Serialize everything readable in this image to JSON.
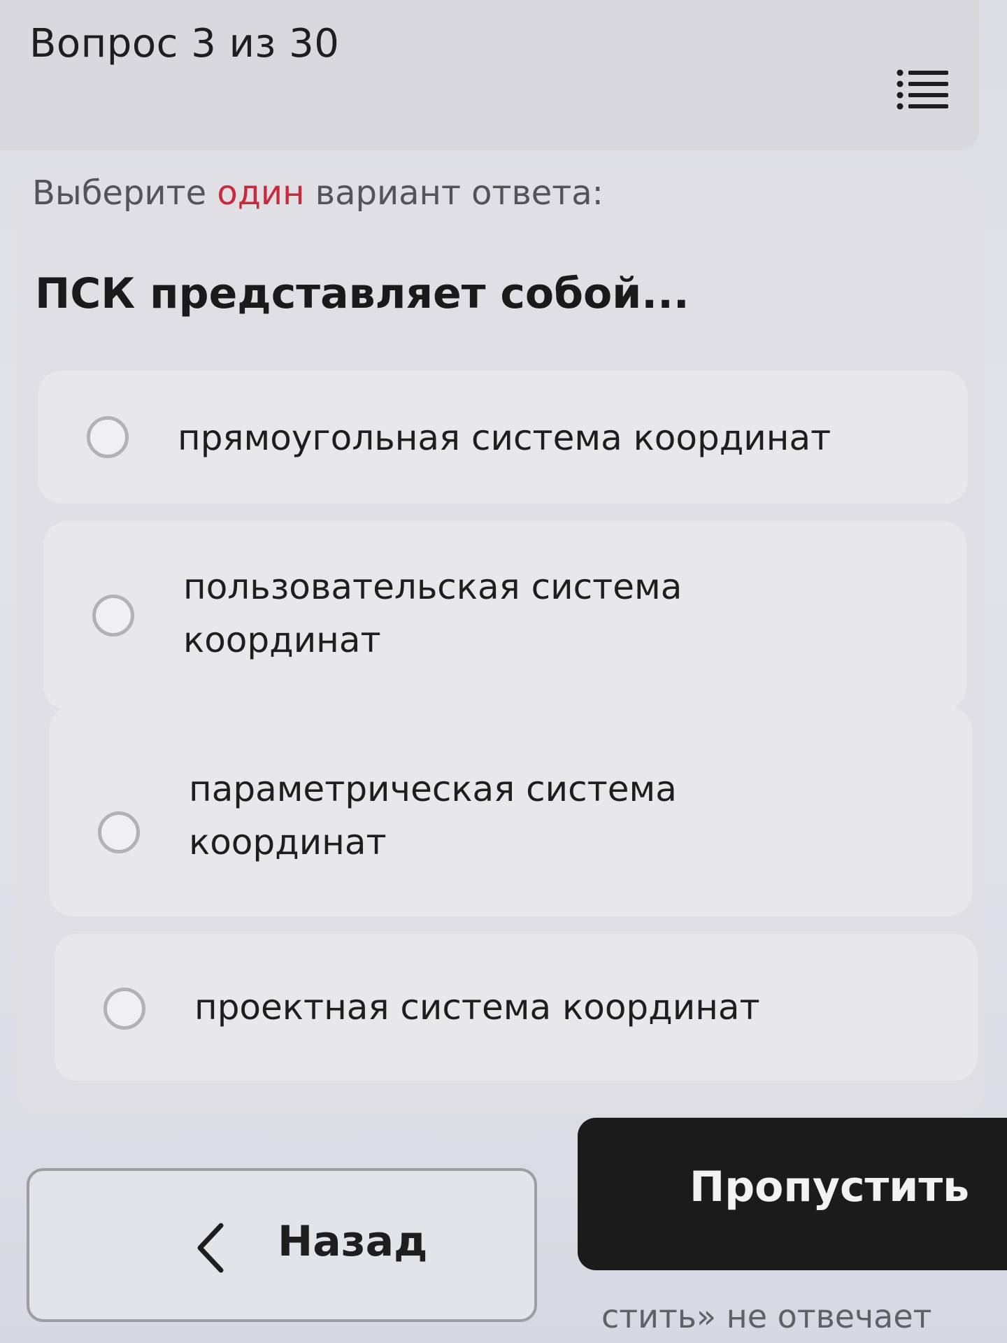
{
  "header": {
    "counter": "Вопрос 3 из 30",
    "menu_icon": "list-icon"
  },
  "question": {
    "instruction_before": "Выберите ",
    "instruction_accent": "один",
    "instruction_after": " вариант ответа:",
    "text": "ПСК представляет собой...",
    "accent_color": "#c9293c"
  },
  "options": [
    {
      "label": "прямоугольная система координат",
      "selected": false
    },
    {
      "label": "пользовательская система координат",
      "selected": false
    },
    {
      "label": "параметрическая система координат",
      "selected": false
    },
    {
      "label": "проектная система координат",
      "selected": false
    }
  ],
  "buttons": {
    "back_label": "Назад",
    "back_icon": "chevron-left-icon",
    "skip_label": "Пропустить"
  },
  "footer": {
    "note": "стить» не отвечает"
  }
}
